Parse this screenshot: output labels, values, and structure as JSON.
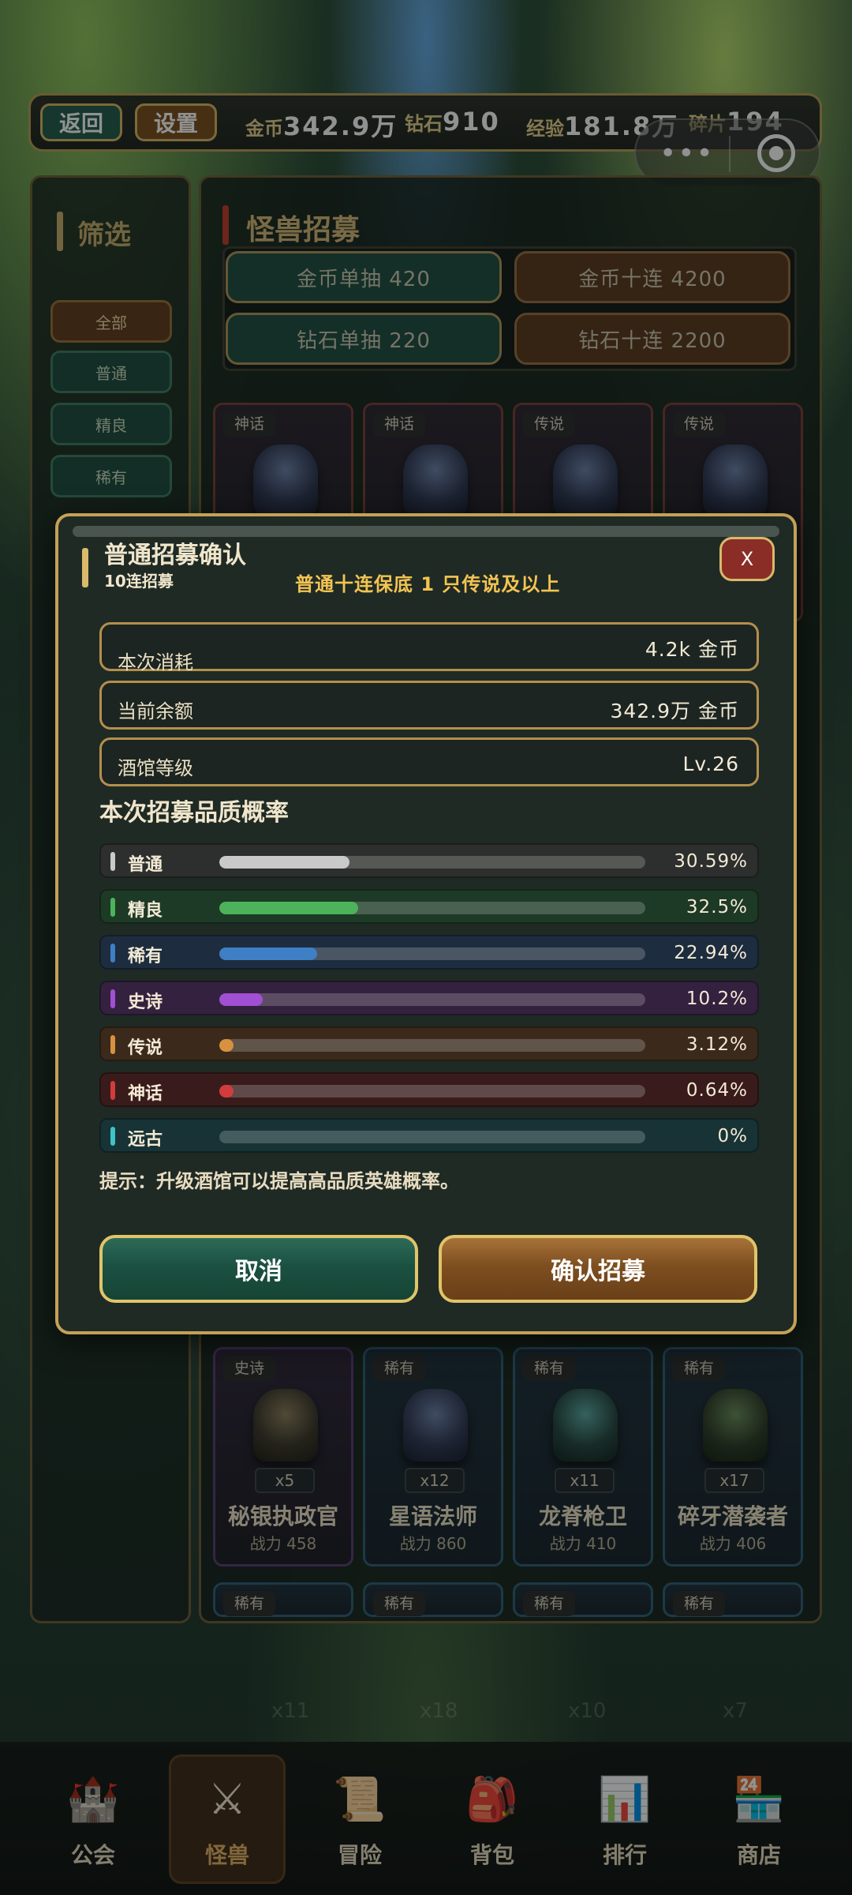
{
  "topbar": {
    "back_label": "返回",
    "settings_label": "设置",
    "gold_label": "金币",
    "gold_value": "342.9万",
    "diamond_label": "钻石",
    "diamond_value": "910",
    "exp_label": "经验",
    "exp_value": "181.8万",
    "shard_label": "碎片",
    "shard_value": "194"
  },
  "sidebar": {
    "title": "筛选",
    "filters": [
      "全部",
      "普通",
      "精良",
      "稀有"
    ]
  },
  "main": {
    "title": "怪兽招募",
    "draw_buttons": [
      {
        "label": "金币单抽 420"
      },
      {
        "label": "金币十连 4200"
      },
      {
        "label": "钻石单抽 220"
      },
      {
        "label": "钻石十连 2200"
      }
    ],
    "top_cards": [
      {
        "tag": "神话"
      },
      {
        "tag": "神话"
      },
      {
        "tag": "传说"
      },
      {
        "tag": "传说"
      }
    ],
    "cards": [
      {
        "tag": "史诗",
        "count": "x5",
        "name": "秘银执政官",
        "power": "战力 458"
      },
      {
        "tag": "稀有",
        "count": "x12",
        "name": "星语法师",
        "power": "战力 860"
      },
      {
        "tag": "稀有",
        "count": "x11",
        "name": "龙脊枪卫",
        "power": "战力 410"
      },
      {
        "tag": "稀有",
        "count": "x17",
        "name": "碎牙潜袭者",
        "power": "战力 406"
      }
    ],
    "bottom_tags": [
      "稀有",
      "稀有",
      "稀有",
      "稀有"
    ],
    "ghost_counts": [
      "x11",
      "x18",
      "x10",
      "x7"
    ]
  },
  "modal": {
    "title": "普通招募确认",
    "subtitle": "10连招募",
    "guarantee": "普通十连保底 1 只传说及以上",
    "close_label": "X",
    "rows": [
      {
        "label": "本次消耗",
        "value": "4.2k 金币"
      },
      {
        "label": "当前余额",
        "value": "342.9万 金币"
      },
      {
        "label": "酒馆等级",
        "value": "Lv.26"
      }
    ],
    "prob_title": "本次招募品质概率",
    "probabilities": [
      {
        "name": "普通",
        "pct": "30.59%",
        "value": 30.59,
        "color": "#c9c9c9",
        "bg": "#2c2f2d"
      },
      {
        "name": "精良",
        "pct": "32.5%",
        "value": 32.5,
        "color": "#4cb35a",
        "bg": "#1d3a26"
      },
      {
        "name": "稀有",
        "pct": "22.94%",
        "value": 22.94,
        "color": "#3f7fc6",
        "bg": "#1d2d3f"
      },
      {
        "name": "史诗",
        "pct": "10.2%",
        "value": 10.2,
        "color": "#a14fd3",
        "bg": "#34213f"
      },
      {
        "name": "传说",
        "pct": "3.12%",
        "value": 3.12,
        "color": "#d8913e",
        "bg": "#3b2a1b"
      },
      {
        "name": "神话",
        "pct": "0.64%",
        "value": 0.64,
        "color": "#d23c3c",
        "bg": "#3a1b1b"
      },
      {
        "name": "远古",
        "pct": "0%",
        "value": 0,
        "color": "#3fc2c9",
        "bg": "#173336"
      }
    ],
    "tip": "提示：升级酒馆可以提高高品质英雄概率。",
    "cancel_label": "取消",
    "confirm_label": "确认招募"
  },
  "nav": [
    {
      "label": "公会",
      "icon": "castle-icon"
    },
    {
      "label": "怪兽",
      "icon": "crossed-swords-icon"
    },
    {
      "label": "冒险",
      "icon": "map-scroll-icon"
    },
    {
      "label": "背包",
      "icon": "backpack-icon"
    },
    {
      "label": "排行",
      "icon": "bar-chart-icon"
    },
    {
      "label": "商店",
      "icon": "shop-icon"
    }
  ]
}
